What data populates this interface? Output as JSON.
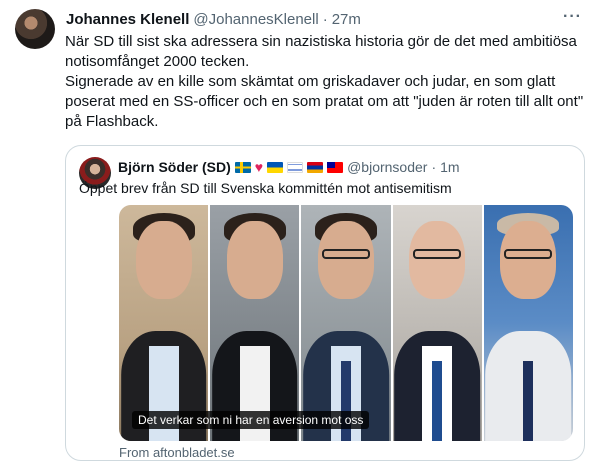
{
  "tweet": {
    "author_name": "Johannes Klenell",
    "handle": "@JohannesKlenell",
    "separator": "·",
    "time": "27m",
    "more_label": "···",
    "lines": [
      "När SD till sist ska adressera sin nazistiska historia gör de det med ambitiösa notisomfånget 2000 tecken.",
      "Signerade av en kille som skämtat om griskadaver och judar, en som glatt poserat med en SS-officer och en som pratat om att \"juden är roten till allt ont\" på Flashback."
    ]
  },
  "quoted_tweet": {
    "author_name": "Björn Söder (SD)",
    "flags": [
      "sweden-flag",
      "red-heart",
      "ukraine-flag",
      "israel-flag",
      "armenia-flag",
      "taiwan-flag"
    ],
    "handle": "@bjornsoder",
    "separator": "·",
    "time": "1m",
    "text": "Öppet brev från SD till Svenska kommittén mot antisemitism",
    "media_caption": "Det verkar som ni har en aversion mot oss",
    "source": "From aftonbladet.se"
  }
}
